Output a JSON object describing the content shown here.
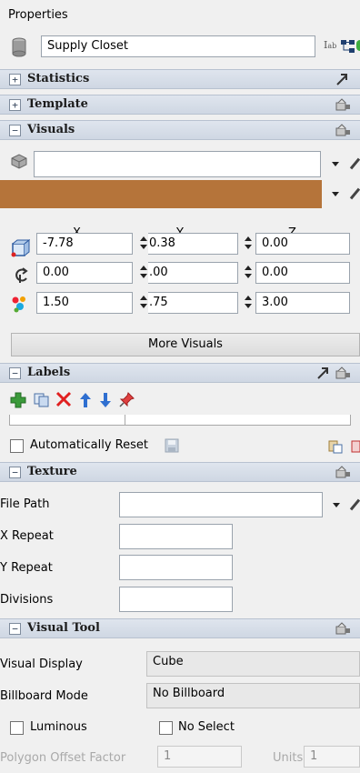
{
  "panel": {
    "title": "Properties"
  },
  "object": {
    "name": "Supply Closet",
    "icon": "cylinder-icon"
  },
  "sections": {
    "statistics": "Statistics",
    "template": "Template",
    "visuals": "Visuals",
    "labels": "Labels",
    "texture": "Texture",
    "visual_tool": "Visual Tool"
  },
  "visuals": {
    "shape_value": "",
    "color": "#b5743a",
    "axis_headers": [
      "X",
      "Y",
      "Z"
    ],
    "position": {
      "x": "-7.78",
      "y": "0.38",
      "z": "0.00"
    },
    "rotation": {
      "x": "0.00",
      "y": ".00",
      "z": "0.00"
    },
    "size": {
      "x": "1.50",
      "y": ".75",
      "z": "3.00"
    },
    "more_button": "More Visuals"
  },
  "labels": {
    "auto_reset_label": "Automatically Reset"
  },
  "texture": {
    "file_path_label": "File Path",
    "file_path_value": "",
    "x_repeat_label": "X Repeat",
    "x_repeat_value": "",
    "y_repeat_label": "Y Repeat",
    "y_repeat_value": "",
    "divisions_label": "Divisions",
    "divisions_value": ""
  },
  "visual_tool": {
    "visual_display_label": "Visual Display",
    "visual_display_value": "Cube",
    "billboard_label": "Billboard Mode",
    "billboard_value": "No Billboard",
    "luminous_label": "Luminous",
    "no_select_label": "No Select",
    "polygon_offset_label": "Polygon Offset Factor",
    "polygon_offset_value": "1",
    "units_label": "Units",
    "units_value": "1"
  }
}
